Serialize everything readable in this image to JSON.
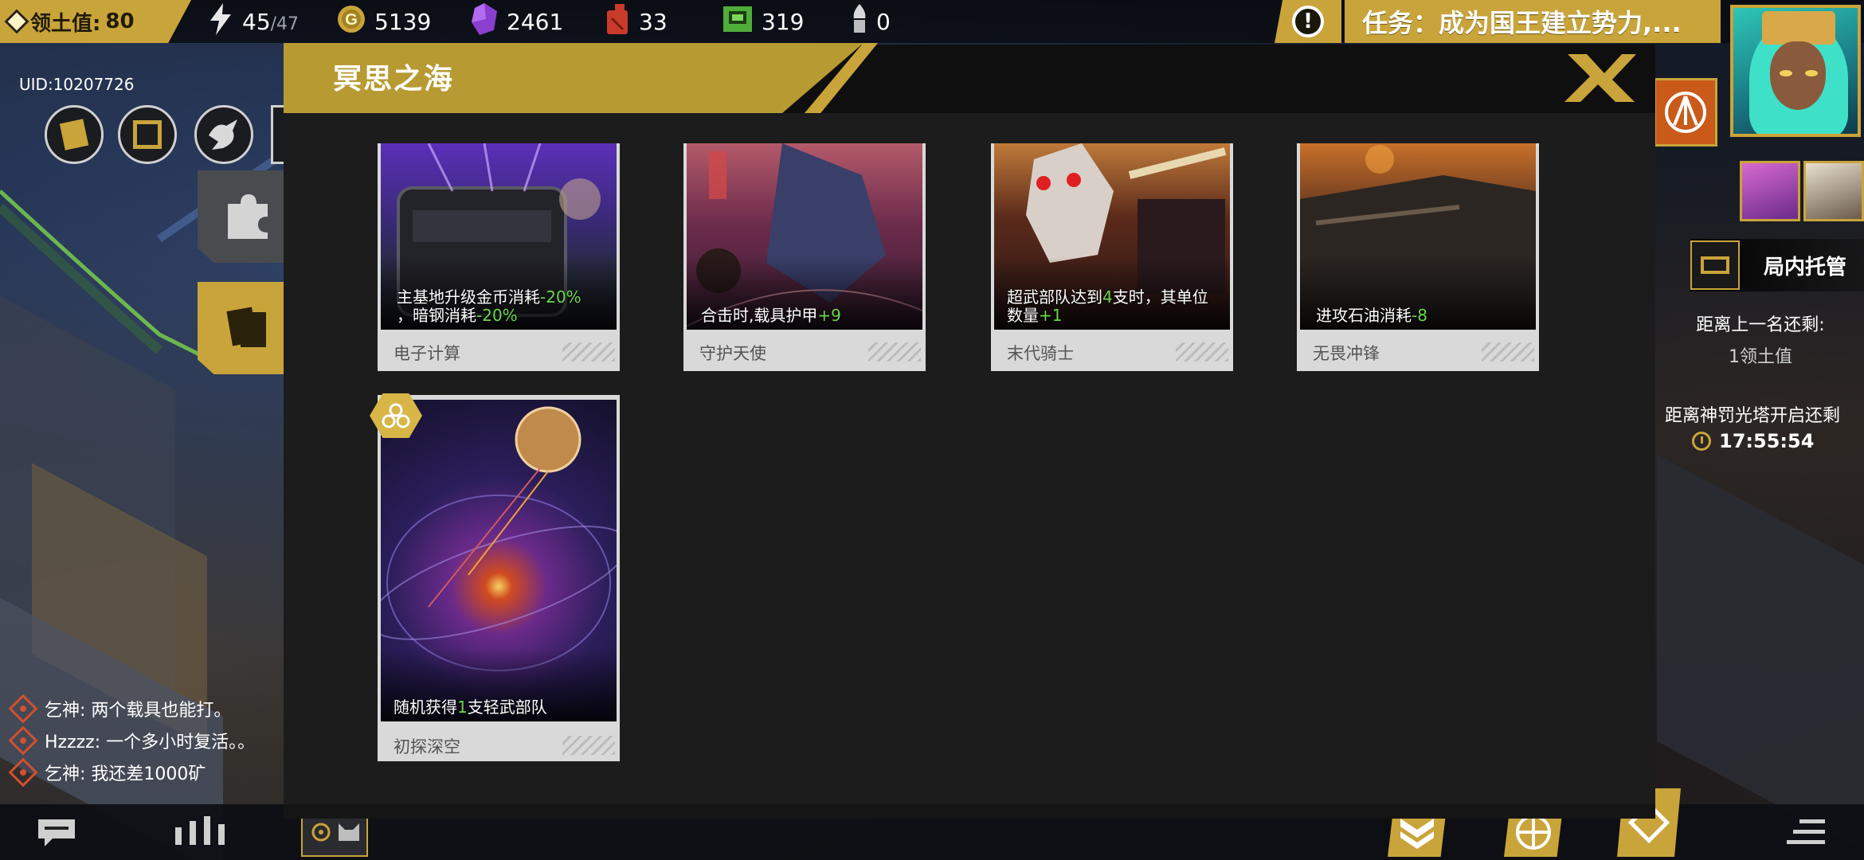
{
  "hud": {
    "territory_label": "领土值:",
    "territory_value": "80",
    "energy": "45",
    "energy_max": "/47",
    "gold": "5139",
    "crystal": "2461",
    "oil": "33",
    "chip": "319",
    "bullet": "0",
    "quest_text": "任务：成为国王建立势力,...",
    "uid": "UID:10207726"
  },
  "modal": {
    "title": "冥思之海",
    "cards": [
      {
        "desc_parts": [
          "主基地升级金币消耗",
          "-20%",
          "，暗钢消耗",
          "-20%"
        ],
        "name": "电子计算"
      },
      {
        "desc_parts": [
          "合击时,载具护甲",
          "+9"
        ],
        "name": "守护天使"
      },
      {
        "desc_parts": [
          "超武部队达到",
          "4",
          "支时，其单位数量",
          "+1"
        ],
        "name": "末代骑士"
      },
      {
        "desc_parts": [
          "进攻石油消耗",
          "-8"
        ],
        "name": "无畏冲锋"
      },
      {
        "desc_parts": [
          "随机获得",
          "1",
          "支轻武部队"
        ],
        "name": "初探深空"
      }
    ]
  },
  "right": {
    "auto_label": "局内托管",
    "prev_rank_label": "距离上一名还剩:",
    "prev_rank_value": "1领土值",
    "tower_label": "距离神罚光塔开启还剩",
    "tower_time": "17:55:54"
  },
  "chat": [
    {
      "user": "乞神",
      "text": "两个载具也能打。"
    },
    {
      "user": "Hzzzz",
      "text": "一个多小时复活。。"
    },
    {
      "user": "乞神",
      "text": "我还差1000矿"
    }
  ],
  "colors": {
    "gold": "#c9a43a",
    "highlight_green": "#6bd84a",
    "panel": "#1c1c1c"
  }
}
